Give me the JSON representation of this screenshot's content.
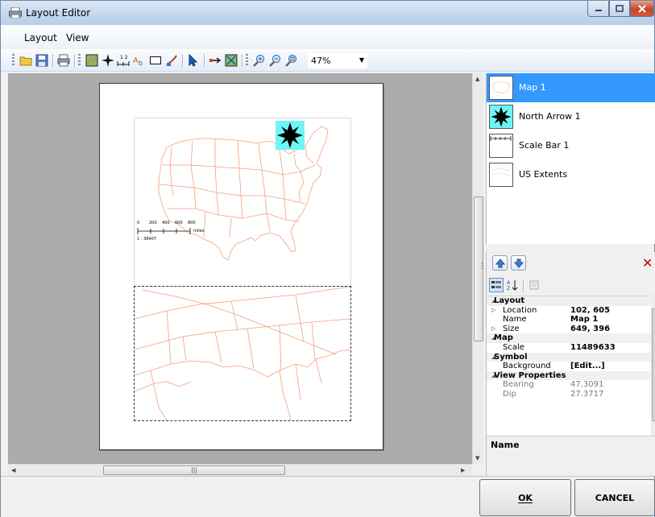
{
  "window": {
    "title": "Layout Editor"
  },
  "menu": {
    "items": [
      "Layout",
      "View"
    ]
  },
  "toolbar": {
    "zoom_value": "47%"
  },
  "layers": [
    {
      "label": "Map 1",
      "selected": true
    },
    {
      "label": "North Arrow 1",
      "selected": false
    },
    {
      "label": "Scale Bar 1",
      "selected": false
    },
    {
      "label": "US Extents",
      "selected": false
    }
  ],
  "scale_bar": {
    "ticks": [
      "0",
      "200",
      "400",
      "600",
      "800"
    ],
    "unit": "miles",
    "ratio": "1 : 38407"
  },
  "properties": {
    "rows": [
      {
        "type": "category",
        "name": "Layout"
      },
      {
        "type": "prop",
        "name": "Location",
        "value": "102, 605",
        "expandable": true
      },
      {
        "type": "prop",
        "name": "Name",
        "value": "Map 1"
      },
      {
        "type": "prop",
        "name": "Size",
        "value": "649, 396",
        "expandable": true
      },
      {
        "type": "category",
        "name": "Map"
      },
      {
        "type": "prop",
        "name": "Scale",
        "value": "11489633"
      },
      {
        "type": "category",
        "name": "Symbol"
      },
      {
        "type": "prop",
        "name": "Background",
        "value": "[Edit...]"
      },
      {
        "type": "category",
        "name": "View Properties"
      },
      {
        "type": "prop",
        "name": "Bearing",
        "value": "47.3091",
        "dim": true
      },
      {
        "type": "prop",
        "name": "Dip",
        "value": "27.3717",
        "dim": true
      }
    ],
    "description_title": "Name"
  },
  "buttons": {
    "ok": "OK",
    "cancel": "CANCEL"
  },
  "colors": {
    "map_outline": "#f3a07c",
    "selection": "#3399ff",
    "north_arrow_bg": "#6ff5f5",
    "canvas_bg": "#ababab"
  }
}
